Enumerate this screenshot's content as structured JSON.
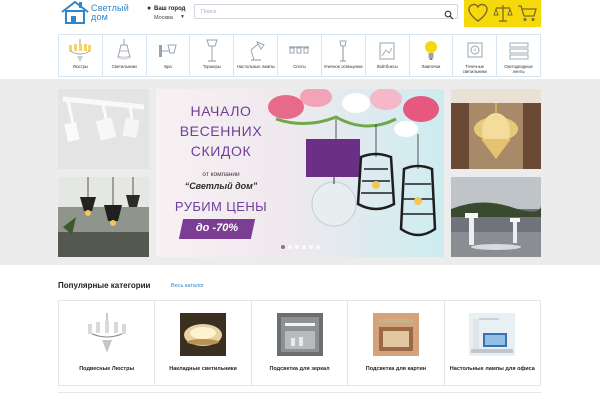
{
  "header": {
    "logo_line1": "Светлый",
    "logo_line2": "дом",
    "city_label": "Ваш город",
    "city_value": "Москва",
    "search_placeholder": "Поиск"
  },
  "actions": [
    {
      "name": "favorites",
      "icon": "heart-icon"
    },
    {
      "name": "compare",
      "icon": "scales-icon"
    },
    {
      "name": "cart",
      "icon": "cart-icon"
    }
  ],
  "categories": [
    {
      "label": "Люстры",
      "icon": "chandelier-icon"
    },
    {
      "label": "Светильники",
      "icon": "ceiling-lamp-icon"
    },
    {
      "label": "Бра",
      "icon": "wall-lamp-icon"
    },
    {
      "label": "Торшеры",
      "icon": "floor-lamp-icon"
    },
    {
      "label": "Настольные лампы",
      "icon": "desk-lamp-icon"
    },
    {
      "label": "Споты",
      "icon": "spot-icon"
    },
    {
      "label": "Уличное освещение",
      "icon": "street-lamp-icon"
    },
    {
      "label": "Лайтбоксы",
      "icon": "lightbox-icon"
    },
    {
      "label": "Лампочки",
      "icon": "bulb-icon"
    },
    {
      "label": "Точечные светильники",
      "icon": "downlight-icon"
    },
    {
      "label": "Светодиодные ленты",
      "icon": "led-strip-icon"
    }
  ],
  "banner": {
    "line1": "НАЧАЛО",
    "line2": "ВЕСЕННИХ",
    "line3": "СКИДОК",
    "sub": "от компании",
    "company": "“Светлый дом”",
    "cta": "РУБИМ ЦЕНЫ",
    "badge": "до -70%"
  },
  "slider": {
    "dots": 6,
    "active": 0
  },
  "popular": {
    "title": "Популярные категории",
    "link": "Весь каталог",
    "items": [
      {
        "label": "Подвесные Люстры"
      },
      {
        "label": "Накладные светильники"
      },
      {
        "label": "Подсветка для зеркал"
      },
      {
        "label": "Подсветка для картин"
      },
      {
        "label": "Настольные лампы для офиса"
      }
    ]
  },
  "colors": {
    "brand_blue": "#2f86c9",
    "accent_yellow": "#f5d90b",
    "banner_purple": "#6f3f9a",
    "band_gray": "#ececec"
  }
}
